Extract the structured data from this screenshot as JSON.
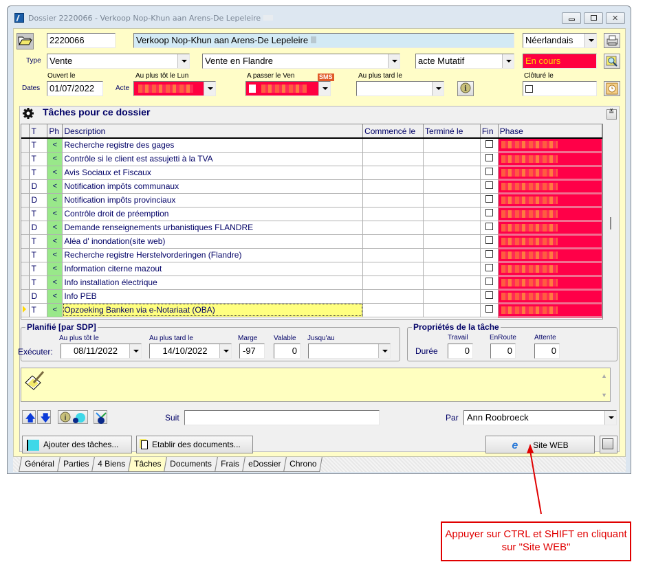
{
  "window": {
    "title": "Dossier 2220066 - Verkoop Nop-Khun aan Arens-De Lepeleire",
    "controls": [
      "minimize",
      "maximize",
      "close"
    ]
  },
  "header": {
    "dossier_number": "2220066",
    "dossier_title": "Verkoop Nop-Khun aan Arens-De Lepeleire",
    "language": "Néerlandais",
    "type_label": "Type",
    "type_value": "Vente",
    "subtype_value": "Vente en Flandre",
    "acte_type_value": "acte Mutatif",
    "status_value": "En cours",
    "dates_label": "Dates",
    "ouvert_label": "Ouvert le",
    "ouvert_value": "01/07/2022",
    "acte_label": "Acte",
    "au_plus_tot_label": "Au plus tôt le Lun",
    "a_passer_label": "A passer le Ven",
    "sms_badge": "SMS",
    "au_plus_tard_label": "Au plus tard le",
    "au_plus_tard_value": "",
    "cloture_label": "Clôturé le",
    "cloture_checked": false
  },
  "tasks": {
    "title": "Tâches pour ce dossier",
    "columns": [
      "T",
      "Ph",
      "Description",
      "Commencé le",
      "Terminé le",
      "Fin",
      "Phase"
    ],
    "rows": [
      {
        "t": "T",
        "ph": "<",
        "description": "Recherche registre des gages",
        "commence": "",
        "termine": "",
        "fin": false
      },
      {
        "t": "T",
        "ph": "<",
        "description": "Contrôle si le client est assujetti à la TVA",
        "commence": "",
        "termine": "",
        "fin": false
      },
      {
        "t": "T",
        "ph": "<",
        "description": "Avis Sociaux et Fiscaux",
        "commence": "",
        "termine": "",
        "fin": false
      },
      {
        "t": "D",
        "ph": "<",
        "description": "Notification impôts communaux",
        "commence": "",
        "termine": "",
        "fin": false
      },
      {
        "t": "D",
        "ph": "<",
        "description": "Notification impôts provinciaux",
        "commence": "",
        "termine": "",
        "fin": false
      },
      {
        "t": "T",
        "ph": "<",
        "description": "Contrôle droit de préemption",
        "commence": "",
        "termine": "",
        "fin": false
      },
      {
        "t": "D",
        "ph": "<",
        "description": "Demande renseignements urbanistiques FLANDRE",
        "commence": "",
        "termine": "",
        "fin": false
      },
      {
        "t": "T",
        "ph": "<",
        "description": "Aléa d' inondation(site web)",
        "commence": "",
        "termine": "",
        "fin": false
      },
      {
        "t": "T",
        "ph": "<",
        "description": "Recherche registre Herstelvorderingen (Flandre)",
        "commence": "",
        "termine": "",
        "fin": false
      },
      {
        "t": "T",
        "ph": "<",
        "description": "Information citerne mazout",
        "commence": "",
        "termine": "",
        "fin": false
      },
      {
        "t": "T",
        "ph": "<",
        "description": "Info installation électrique",
        "commence": "",
        "termine": "",
        "fin": false
      },
      {
        "t": "D",
        "ph": "<",
        "description": "Info PEB",
        "commence": "",
        "termine": "",
        "fin": false
      },
      {
        "t": "T",
        "ph": "<",
        "description": "Opzoeking Banken via e-Notariaat (OBA)",
        "commence": "",
        "termine": "",
        "fin": false,
        "current": true
      }
    ]
  },
  "planifie": {
    "title": "Planifié  [par SDP]",
    "executer_label": "Exécuter:",
    "au_plus_tot_label": "Au plus tôt le",
    "au_plus_tot_value": "08/11/2022",
    "au_plus_tard_label": "Au plus tard le",
    "au_plus_tard_value": "14/10/2022",
    "marge_label": "Marge",
    "marge_value": "-97",
    "valable_label": "Valable",
    "valable_value": "0",
    "jusquau_label": "Jusqu'au",
    "jusquau_value": ""
  },
  "proprietes": {
    "title": "Propriétés de la tâche",
    "duree_label": "Durée",
    "travail_label": "Travail",
    "travail_value": "0",
    "enroute_label": "EnRoute",
    "enroute_value": "0",
    "attente_label": "Attente",
    "attente_value": "0"
  },
  "footer": {
    "suit_label": "Suit",
    "suit_value": "",
    "par_label": "Par",
    "par_value": "Ann Roobroeck",
    "ajouter_button": "Ajouter des tâches...",
    "etablir_button": "Etablir des documents...",
    "site_web_button": "Site WEB"
  },
  "tabs": [
    {
      "label": "Général",
      "active": false
    },
    {
      "label": "Parties",
      "active": false
    },
    {
      "label": "4 Biens",
      "active": false
    },
    {
      "label": "Tâches",
      "active": true
    },
    {
      "label": "Documents",
      "active": false
    },
    {
      "label": "Frais",
      "active": false
    },
    {
      "label": "eDossier",
      "active": false
    },
    {
      "label": "Chrono",
      "active": false
    }
  ],
  "annotation": {
    "text": "Appuyer sur CTRL et SHIFT en cliquant sur \"Site WEB\"",
    "color": "#e00000"
  }
}
